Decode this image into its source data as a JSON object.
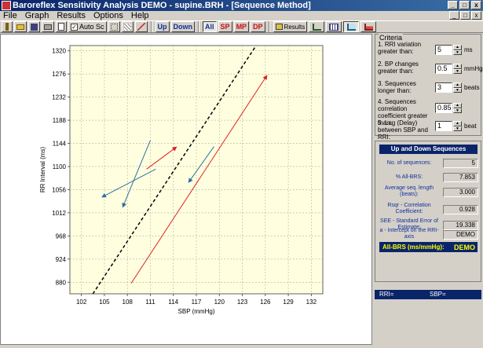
{
  "window": {
    "title": "Baroreflex Sensitivity Analysis DEMO - supine.BRH - [Sequence Method]",
    "min_label": "_",
    "max_label": "□",
    "close_label": "x"
  },
  "menu": {
    "items": [
      "File",
      "Graph",
      "Results",
      "Options",
      "Help"
    ]
  },
  "toolbar": {
    "autosc_label": "Auto Sc",
    "autosc_checked_mark": "✓",
    "up_label": "Up",
    "down_label": "Down",
    "all_label": "All",
    "sp_label": "SP",
    "mp_label": "MP",
    "dp_label": "DP",
    "results_label": "Results"
  },
  "criteria": {
    "title": "Criteria",
    "rows": [
      {
        "label": "1. RRI variation greater than:",
        "value": "5",
        "unit": "ms"
      },
      {
        "label": "2. BP changes greater than:",
        "value": "0.5",
        "unit": "mmHg"
      },
      {
        "label": "3. Sequences longer than:",
        "value": "3",
        "unit": "beats"
      },
      {
        "label": "4. Sequences correlation coefficient greater than:",
        "value": "0.85",
        "unit": ""
      },
      {
        "label": "5. Lag (Delay) between SBP and RRI:",
        "value": "1",
        "unit": "beat"
      }
    ]
  },
  "updown": {
    "title": "Up and Down Sequences",
    "rows": [
      {
        "label": "No. of sequences:",
        "value": "5"
      },
      {
        "label": "% All-BRS:",
        "value": "7.853"
      },
      {
        "label": "Average seq. length (beats):",
        "value": "3.000"
      },
      {
        "label": "Rsqr - Correlation Coefficient:",
        "value": "0.928"
      },
      {
        "label": "SEE - Standard Error of Estimate:",
        "value": "19.338"
      },
      {
        "label": "a - Intercept on the RRI-axis",
        "value": "DEMO"
      }
    ],
    "allbrs_label": "All-BRS (ms/mmHg):",
    "allbrs_value": "DEMO"
  },
  "status": {
    "rri_label": "RRI=",
    "sbp_label": "SBP="
  },
  "colors": {
    "plot_bg": "#ffffe0",
    "grid": "#b0b0a0",
    "blue_seq": "#3070a0",
    "red_seq": "#e02020",
    "regression": "#000000",
    "titlebar": "#0a246a"
  },
  "chart_data": {
    "type": "scatter",
    "title": "",
    "xlabel": "SBP (mmHg)",
    "ylabel": "RR Interval (ms)",
    "xlim": [
      100.5,
      133.5
    ],
    "ylim": [
      858,
      1330
    ],
    "x_ticks": [
      102,
      105,
      108,
      111,
      114,
      117,
      120,
      123,
      126,
      129,
      132
    ],
    "y_ticks": [
      880,
      924,
      968,
      1012,
      1056,
      1100,
      1144,
      1188,
      1232,
      1276,
      1320
    ],
    "grid": true,
    "legend": "none",
    "series": [
      {
        "style": "blue-arrow",
        "points": [
          [
            111.0,
            1150
          ],
          [
            107.4,
            1023
          ]
        ]
      },
      {
        "style": "blue-arrow",
        "points": [
          [
            111.7,
            1095
          ],
          [
            104.7,
            1042
          ]
        ]
      },
      {
        "style": "blue-arrow",
        "points": [
          [
            119.3,
            1138
          ],
          [
            116.0,
            1070
          ]
        ]
      },
      {
        "style": "red-arrow",
        "points": [
          [
            110.5,
            1095
          ],
          [
            114.4,
            1137
          ]
        ]
      },
      {
        "style": "red-arrow",
        "points": [
          [
            108.5,
            878
          ],
          [
            126.2,
            1273
          ]
        ]
      },
      {
        "style": "dashed-line",
        "points": [
          [
            103.5,
            858
          ],
          [
            124.8,
            1330
          ]
        ]
      }
    ]
  }
}
